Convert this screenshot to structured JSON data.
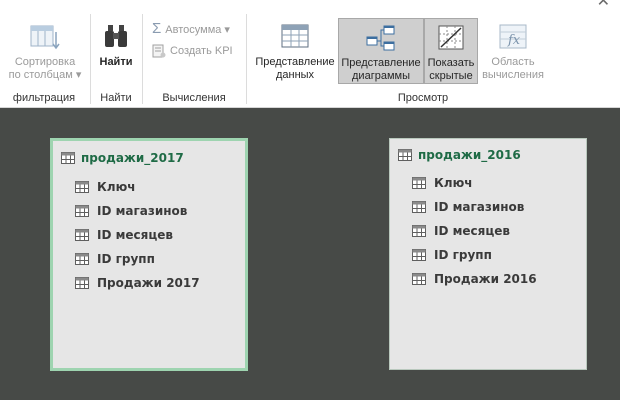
{
  "ribbon": {
    "close_glyph": "✕",
    "groups": {
      "filter": {
        "label": "фильтрация",
        "sort_button": {
          "line1": "Сортировка",
          "line2": "по столбцам ▾",
          "icon": "sort-columns-icon"
        }
      },
      "find": {
        "label": "Найти",
        "find_button": {
          "label": "Найти",
          "icon": "binoculars-icon"
        }
      },
      "calc": {
        "label": "Вычисления",
        "autosum": {
          "label": "Автосумма ▾",
          "icon": "sigma-icon"
        },
        "create_kpi": {
          "label": "Создать KPI",
          "icon": "kpi-icon"
        }
      },
      "view": {
        "label": "Просмотр",
        "data_view": {
          "line1": "Представление",
          "line2": "данных",
          "icon": "data-view-icon"
        },
        "diagram_view": {
          "line1": "Представление",
          "line2": "диаграммы",
          "icon": "diagram-view-icon"
        },
        "show_hidden": {
          "line1": "Показать",
          "line2": "скрытые",
          "icon": "show-hidden-icon"
        },
        "calc_area": {
          "line1": "Область",
          "line2": "вычисления",
          "icon": "fx-icon"
        }
      }
    }
  },
  "diagram": {
    "tables": [
      {
        "name": "продажи_2017",
        "columns": [
          "Ключ",
          "ID магазинов",
          "ID месяцев",
          "ID групп",
          "Продажи 2017"
        ]
      },
      {
        "name": "продажи_2016",
        "columns": [
          "Ключ",
          "ID магазинов",
          "ID месяцев",
          "ID групп",
          "Продажи 2016"
        ]
      }
    ]
  },
  "colors": {
    "canvas": "#474a47",
    "table_title": "#1f6b46",
    "selected_border": "#9ed4b0"
  }
}
